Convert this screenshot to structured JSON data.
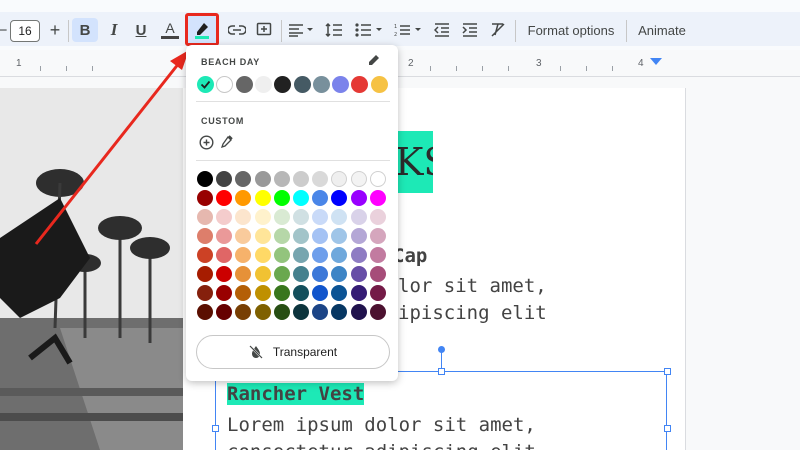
{
  "toolbar": {
    "minus": "−",
    "font_size": "16",
    "plus": "+",
    "bold": "B",
    "italic": "I",
    "underline": "U",
    "text_color": "A",
    "format_options": "Format options",
    "animate": "Animate"
  },
  "ruler": {
    "numbers": [
      "1",
      "2",
      "3",
      "4"
    ]
  },
  "document": {
    "title_fragment": "KS",
    "heading1": "Cap",
    "body1_line1": "lor sit amet,",
    "body1_line2": "ipiscing elit",
    "heading2": "Rancher Vest",
    "body2_line1": "Lorem ipsum dolor sit amet,",
    "body2_line2": "consectetur adipiscing elit"
  },
  "popup": {
    "theme_label": "BEACH DAY",
    "custom_label": "CUSTOM",
    "transparent_label": "Transparent",
    "theme_colors": [
      "#1de9b6",
      "#ffffff",
      "#666666",
      "#efefef",
      "#212121",
      "#455a64",
      "#78909c",
      "#7b83eb",
      "#e53935",
      "#f6c244"
    ],
    "grid_rows": [
      [
        "#000000",
        "#434343",
        "#666666",
        "#999999",
        "#b7b7b7",
        "#cccccc",
        "#d9d9d9",
        "#efefef",
        "#f3f3f3",
        "#ffffff"
      ],
      [
        "#980000",
        "#ff0000",
        "#ff9900",
        "#ffff00",
        "#00ff00",
        "#00ffff",
        "#4a86e8",
        "#0000ff",
        "#9900ff",
        "#ff00ff"
      ],
      [
        "#e6b8af",
        "#f4cccc",
        "#fce5cd",
        "#fff2cc",
        "#d9ead3",
        "#d0e0e3",
        "#c9daf8",
        "#cfe2f3",
        "#d9d2e9",
        "#ead1dc"
      ],
      [
        "#dd7e6b",
        "#ea9999",
        "#f9cb9c",
        "#ffe599",
        "#b6d7a8",
        "#a2c4c9",
        "#a4c2f4",
        "#9fc5e8",
        "#b4a7d6",
        "#d5a6bd"
      ],
      [
        "#cc4125",
        "#e06666",
        "#f6b26b",
        "#ffd966",
        "#93c47d",
        "#76a5af",
        "#6d9eeb",
        "#6fa8dc",
        "#8e7cc3",
        "#c27ba0"
      ],
      [
        "#a61c00",
        "#cc0000",
        "#e69138",
        "#f1c232",
        "#6aa84f",
        "#45818e",
        "#3c78d8",
        "#3d85c6",
        "#674ea7",
        "#a64d79"
      ],
      [
        "#85200c",
        "#990000",
        "#b45f06",
        "#bf9000",
        "#38761d",
        "#134f5c",
        "#1155cc",
        "#0b5394",
        "#351c75",
        "#741b47"
      ],
      [
        "#5b0f00",
        "#660000",
        "#783f04",
        "#7f6000",
        "#274e13",
        "#0c343d",
        "#1c4587",
        "#073763",
        "#20124d",
        "#4c1130"
      ]
    ]
  },
  "colors": {
    "accent": "#1de9b6",
    "annotation": "#e8281e",
    "selection": "#4285f4"
  }
}
